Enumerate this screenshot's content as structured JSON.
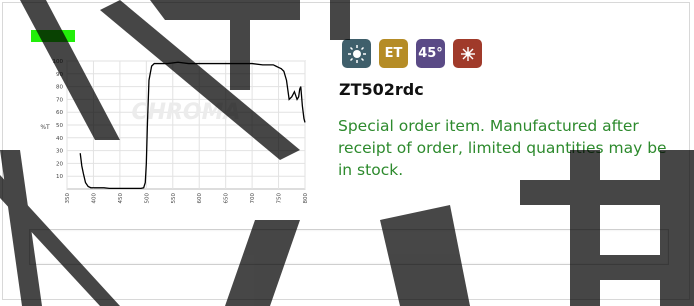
{
  "status_chip": {
    "color": "#22ee0a"
  },
  "icons": [
    {
      "name": "sun-icon",
      "label": "",
      "bg": "#3f5f6b"
    },
    {
      "name": "et-icon",
      "label": "ET",
      "bg": "#b58c26"
    },
    {
      "name": "angle-icon",
      "label": "45°",
      "bg": "#5a4a86"
    },
    {
      "name": "laser-icon",
      "label": "",
      "bg": "#a03a2a"
    }
  ],
  "product": {
    "title": "ZT502rdc",
    "notice": "Special order item. Manufactured after receipt of order, limited quantities may be in stock."
  },
  "colors": {
    "notice_text": "#2d8a2d"
  },
  "chart_data": {
    "type": "line",
    "ylabel": "%T",
    "xlim": [
      350,
      800
    ],
    "ylim": [
      0,
      100
    ],
    "x_ticks": [
      350,
      400,
      450,
      500,
      550,
      600,
      650,
      700,
      750,
      800
    ],
    "y_ticks": [
      10,
      20,
      30,
      40,
      50,
      60,
      70,
      80,
      90,
      100
    ],
    "grid": true,
    "watermark_text": "CHROMA",
    "series": [
      {
        "color": "#000000",
        "x": [
          375,
          378,
          381,
          385,
          390,
          395,
          400,
          410,
          420,
          430,
          440,
          450,
          460,
          470,
          480,
          490,
          495,
          498,
          500,
          502,
          505,
          510,
          515,
          520,
          540,
          560,
          580,
          600,
          620,
          640,
          660,
          680,
          700,
          720,
          740,
          745,
          750,
          755,
          760,
          765,
          770,
          775,
          780,
          785,
          788,
          790,
          792,
          795,
          798,
          800
        ],
        "y": [
          28,
          18,
          12,
          5,
          2,
          1,
          1,
          1,
          1,
          0.5,
          0.5,
          0.5,
          0.5,
          0.5,
          0.5,
          0.5,
          1,
          5,
          20,
          50,
          85,
          96,
          98,
          98,
          98,
          99,
          98,
          98,
          98,
          98,
          98,
          98,
          98,
          97,
          97,
          96,
          95,
          94,
          92,
          85,
          70,
          72,
          76,
          70,
          72,
          78,
          80,
          65,
          55,
          52
        ]
      }
    ]
  }
}
